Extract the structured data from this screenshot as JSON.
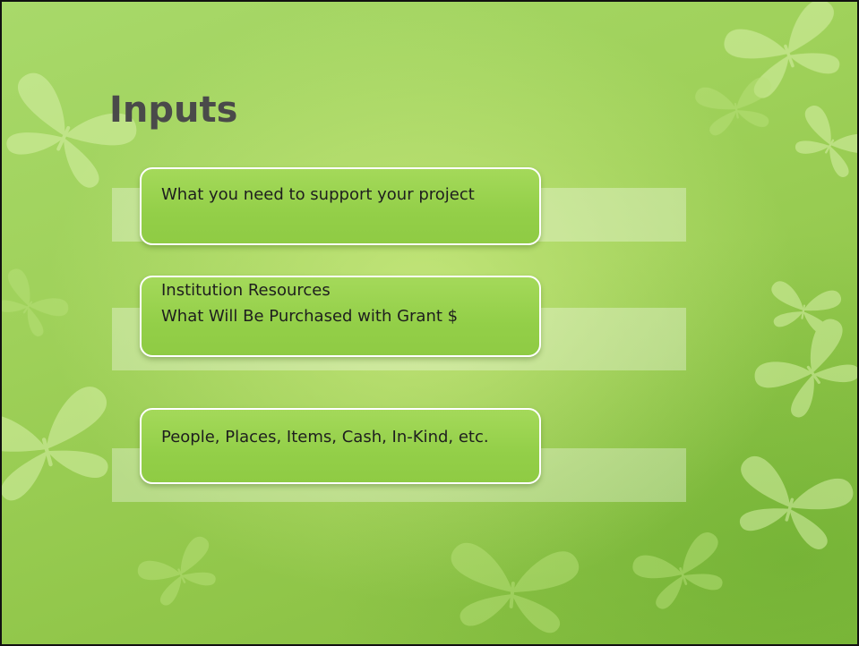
{
  "slide": {
    "title": "Inputs",
    "items": [
      {
        "lines": [
          "What you need to support your project"
        ]
      },
      {
        "lines": [
          "Institution Resources",
          "What Will Be Purchased with Grant $"
        ]
      },
      {
        "lines": [
          "People, Places, Items, Cash, In-Kind, etc."
        ]
      }
    ]
  },
  "theme": {
    "background": "#9fd15a",
    "title_color": "#4a4a4a",
    "card_border": "#ffffff",
    "decoration": "butterfly-silhouettes"
  }
}
